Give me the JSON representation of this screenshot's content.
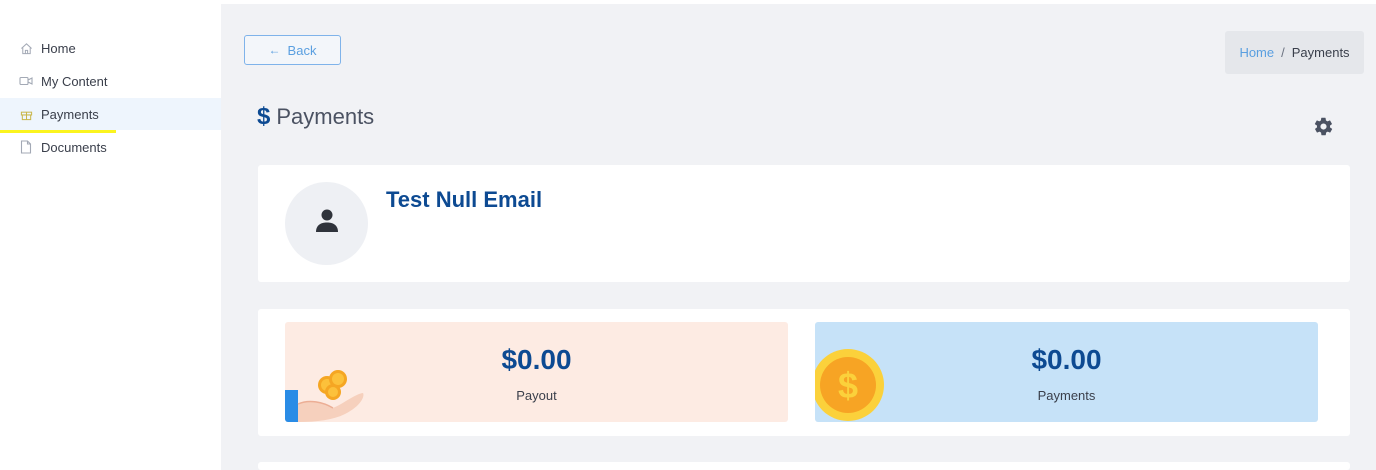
{
  "sidebar": {
    "items": [
      {
        "label": "Home",
        "icon": "home-icon"
      },
      {
        "label": "My Content",
        "icon": "video-icon"
      },
      {
        "label": "Payments",
        "icon": "gift-icon",
        "active": true
      },
      {
        "label": "Documents",
        "icon": "document-icon"
      }
    ]
  },
  "header": {
    "back_label": "Back",
    "back_icon": "arrow-left-icon",
    "breadcrumb": {
      "home": "Home",
      "separator": "/",
      "current": "Payments"
    }
  },
  "page": {
    "title_icon": "$",
    "title": "Payments",
    "settings_icon": "gear-icon"
  },
  "profile": {
    "name": "Test Null Email",
    "avatar_icon": "user-icon"
  },
  "stats": {
    "payout": {
      "amount": "$0.00",
      "label": "Payout",
      "icon": "hand-coins-icon"
    },
    "payments": {
      "amount": "$0.00",
      "label": "Payments",
      "icon": "dollar-coin-icon"
    }
  },
  "colors": {
    "accent": "#0d4a92",
    "link": "#5a9fe0",
    "highlight": "#fbf41f",
    "payout_bg": "#fdebe3",
    "payments_bg": "#c6e2f8"
  }
}
